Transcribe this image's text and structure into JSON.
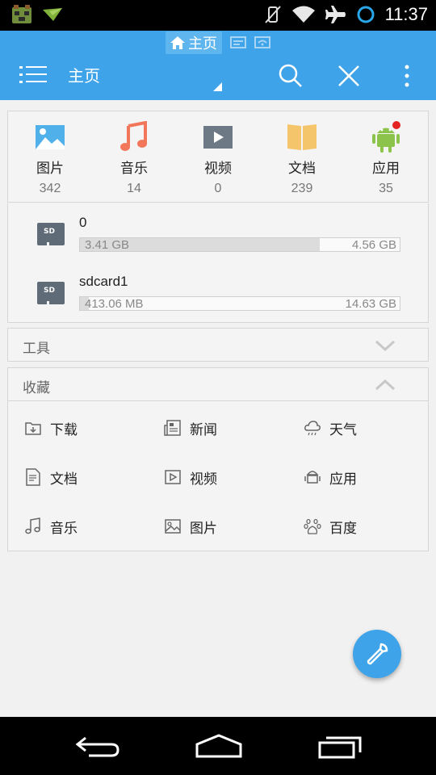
{
  "status_bar": {
    "time": "11:37"
  },
  "breadcrumb": {
    "home_label": "主页"
  },
  "toolbar": {
    "title": "主页"
  },
  "categories": [
    {
      "label": "图片",
      "count": "342",
      "icon": "image-icon"
    },
    {
      "label": "音乐",
      "count": "14",
      "icon": "music-icon"
    },
    {
      "label": "视频",
      "count": "0",
      "icon": "video-icon"
    },
    {
      "label": "文档",
      "count": "239",
      "icon": "document-icon"
    },
    {
      "label": "应用",
      "count": "35",
      "icon": "android-icon"
    }
  ],
  "storage": [
    {
      "name": "0",
      "used": "3.41 GB",
      "total": "4.56 GB",
      "used_fraction": 0.75
    },
    {
      "name": "sdcard1",
      "used": "413.06 MB",
      "total": "14.63 GB",
      "used_fraction": 0.028
    }
  ],
  "sections": {
    "tools": {
      "title": "工具",
      "expanded": false
    },
    "favorites": {
      "title": "收藏",
      "expanded": true
    }
  },
  "favorites": [
    {
      "label": "下载",
      "icon": "download-folder-icon"
    },
    {
      "label": "新闻",
      "icon": "news-icon"
    },
    {
      "label": "天气",
      "icon": "weather-icon"
    },
    {
      "label": "文档",
      "icon": "document-icon"
    },
    {
      "label": "视频",
      "icon": "video-icon"
    },
    {
      "label": "应用",
      "icon": "app-icon"
    },
    {
      "label": "音乐",
      "icon": "music-icon"
    },
    {
      "label": "图片",
      "icon": "image-icon"
    },
    {
      "label": "百度",
      "icon": "baidu-icon"
    }
  ],
  "colors": {
    "accent": "#3ea3e8",
    "status_bar": "#000000",
    "card_background": "#f4f4f4",
    "music": "#f2775a",
    "document": "#f5c56b",
    "android": "#8cc34a",
    "badge": "#e52222"
  }
}
